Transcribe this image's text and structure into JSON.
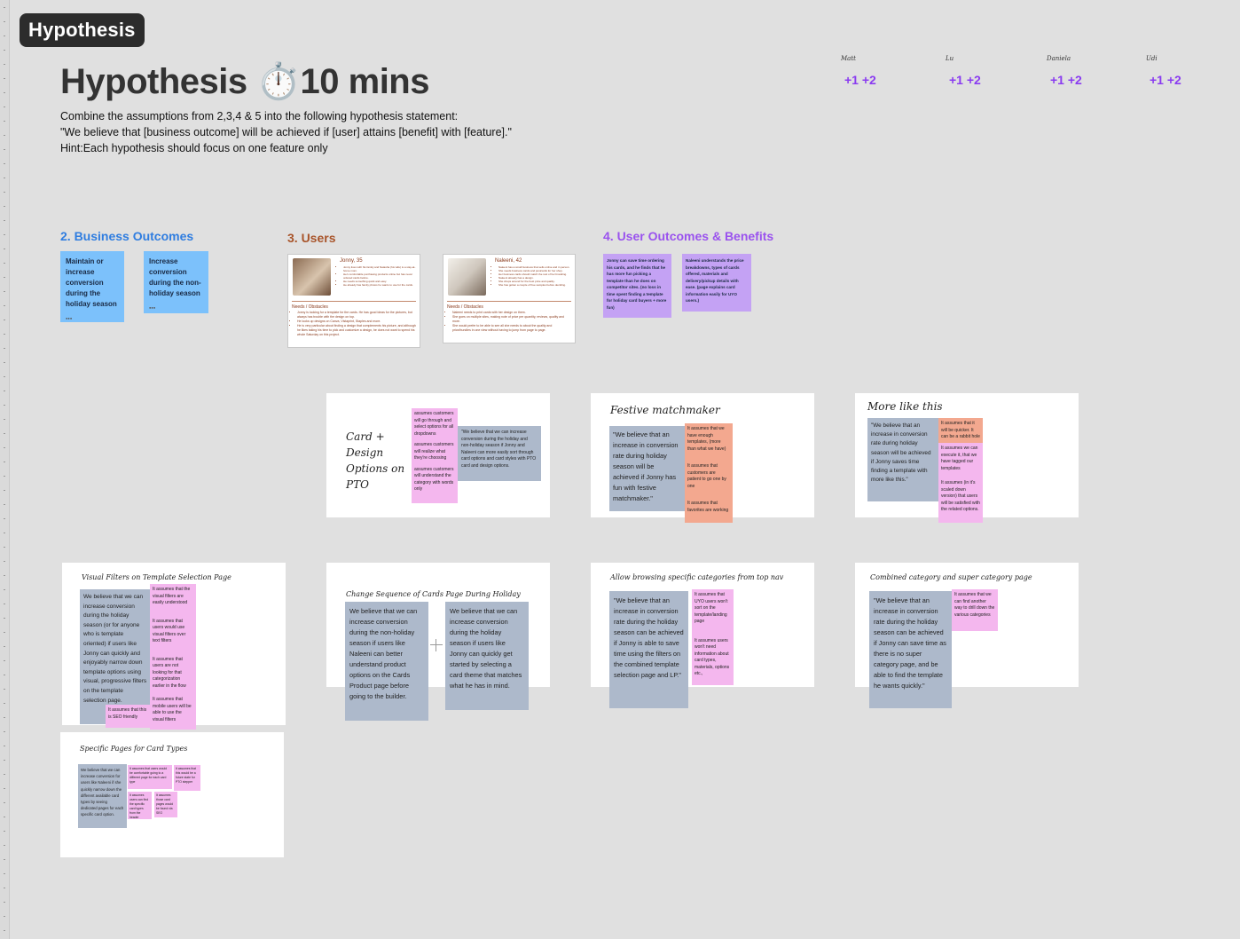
{
  "tag": "Hypothesis",
  "title": "Hypothesis ⏱️10 mins",
  "intro": {
    "line1": "Combine the assumptions from 2,3,4 & 5 into the following hypothesis statement:",
    "line2": "\"We believe that [business outcome] will be achieved if [user] attains [benefit] with [feature].\"",
    "line3": "Hint:Each hypothesis should focus on one feature only"
  },
  "voters": [
    {
      "name": "Matt",
      "votes": "+1 +2"
    },
    {
      "name": "Lu",
      "votes": "+1 +2"
    },
    {
      "name": "Daniela",
      "votes": "+1 +2"
    },
    {
      "name": "Udi",
      "votes": "+1 +2"
    }
  ],
  "sections": {
    "business": "2. Business Outcomes",
    "users": "3. Users",
    "benefits": "4. User Outcomes & Benefits"
  },
  "business_stickies": [
    "Maintain or increase conversion during the holiday season",
    "Increase conversion during the non-holiday season"
  ],
  "personas": [
    {
      "name": "Jonny, 35",
      "bullets": [
        "Jonny lives with his family and Natasha (his wife) is a stay-at-home mom.",
        "He's comfortable purchasing products online but has never ordered cards before.",
        "He needs something quick and easy.",
        "He already has family photos he wants to use for the cards."
      ],
      "needs_title": "Needs / Obstacles",
      "needs": [
        "Jonny is looking for a template for the cards. He has good ideas for the pictures, but always has trouble with the design on top.",
        "He looks up designs on Canva, Vistaprint, Staples and more.",
        "He is very particular about finding a design that complements his picture, and although he likes taking his time to pick and customize a design, he does not want to spend his whole Saturday on this project."
      ]
    },
    {
      "name": "Naleeni, 42",
      "bullets": [
        "Naleeni has a small business that sells online and in person.",
        "She needs business cards and postcards for her shop.",
        "Her business cards should match the rest of her branding.",
        "Naleeni already has a design.",
        "She shops around for the best price and quality.",
        "She has gotten a couple of free samples before deciding."
      ],
      "needs_title": "Needs / Obstacles",
      "needs": [
        "Naleeni needs to print cards with her design on them.",
        "She goes on multiple sites, making note of price per quantity, reviews, quality and more.",
        "She would prefer to be able to see all she needs to about the quality and price/bundles in one view without having to jump from page to page."
      ]
    }
  ],
  "benefit_stickies": [
    "Jonny can save time ordering his cards, and he finds that he has more fun picking a template than he does on competitor sites. (no loss in time spent finding a template for holiday card buyers + more fun)",
    "Naleeni understands the price breakdowns, types of cards offered, materials and delivery/pickup details with ease. (page explains card information easily for UYO users.)"
  ],
  "frames": {
    "card_design": {
      "title": [
        "Card +",
        "Design",
        "Options on",
        "PTO"
      ],
      "assumptions": [
        "assumes customers will go through and select options for all dropdowns",
        "assumes customers will realize what they're choosing",
        "assumes customers will understand the category with words only"
      ],
      "hypothesis": "\"We believe that we can increase conversion during the holiday and non-holiday season if Jonny and Naleeni can more easily sort through card options and card styles with PTO card and design options."
    },
    "festive": {
      "title": "Festive matchmaker",
      "hypothesis": "\"We believe that an increase in conversion rate during holiday season will be achieved if Jonny has fun with festive matchmaker.\"",
      "assumptions": [
        "It assumes that we have enough templates, (more than what we have)",
        "It assumes that customers are patient to go one by one",
        "It assumes that favorites are working"
      ]
    },
    "more_like": {
      "title": "More like this",
      "hypothesis": "\"We believe that an increase in conversion rate during holiday season will be achieved if Jonny saves time finding a template with more like this.\"",
      "assumptions": [
        "It assumes that it will be quicker. It can be a rabbit hole",
        "It assumes we can execute it, that we have tagged our templates",
        "It assumes (in it's scaled down version) that users will be satisfied with the related options."
      ]
    },
    "visual_filters": {
      "title": "Visual Filters on Template Selection Page",
      "hypothesis": "We believe that we can increase conversion during the holiday season (or for anyone who is template oriented) if users like Jonny can quickly and enjoyably narrow down template options using visual, progressive filters on the template selection page.",
      "assumptions": [
        "It assumes that the visual filters are easily understood",
        "It assumes that users would use visual filters over text filters",
        "It assumes that users are not looking for that categorization earlier in the flow",
        "It assumes that mobile users will be able to use the visual filters",
        "It assumes that this is SEO friendly"
      ]
    },
    "change_sequence": {
      "title": "Change Sequence of Cards Page During Holiday",
      "hypothesis_a": "We believe that we can increase conversion during the non-holiday season if users like Naleeni can better understand product options on the Cards Product page before going to the builder.",
      "hypothesis_b": "We believe that we can increase conversion during the holiday season if users like Jonny can quickly get started by selecting a card theme that matches what he has in mind."
    },
    "browsing": {
      "title": "Allow browsing specific categories from top nav",
      "hypothesis": "\"We believe that an increase in conversion rate during the holiday season can be achieved if Jonny is able to save time using the filters on the combined template selection page and LP.\"",
      "assumptions": [
        "It assumes that UYO users won't sort on the template/landing page",
        "It assumes users won't need information about card types, materials, options etc.,"
      ]
    },
    "combined": {
      "title": "Combined category and super category page",
      "hypothesis": "\"We believe that an increase in conversion rate during the holiday season can be achieved if Jonny can save time as there is no super category page, and be able to find the template he wants quickly.\"",
      "assumptions": [
        "It assumes that we can find another way to drill down the various categories"
      ]
    },
    "specific_pages": {
      "title": "Specific Pages for Card Types",
      "hypothesis": "We believe that we can increase conversion for users like Naleeni if she quickly narrow down the different available card types by seeing dedicated pages for each specific card option.",
      "assumptions": [
        "It assumes that users would be comfortable going to a different page for each card type",
        "It assumes that this would be a future state for PTO stepper",
        "It assumes users can find the specific card types from the header",
        "It assumes those card pages would be found via SEO"
      ]
    }
  }
}
